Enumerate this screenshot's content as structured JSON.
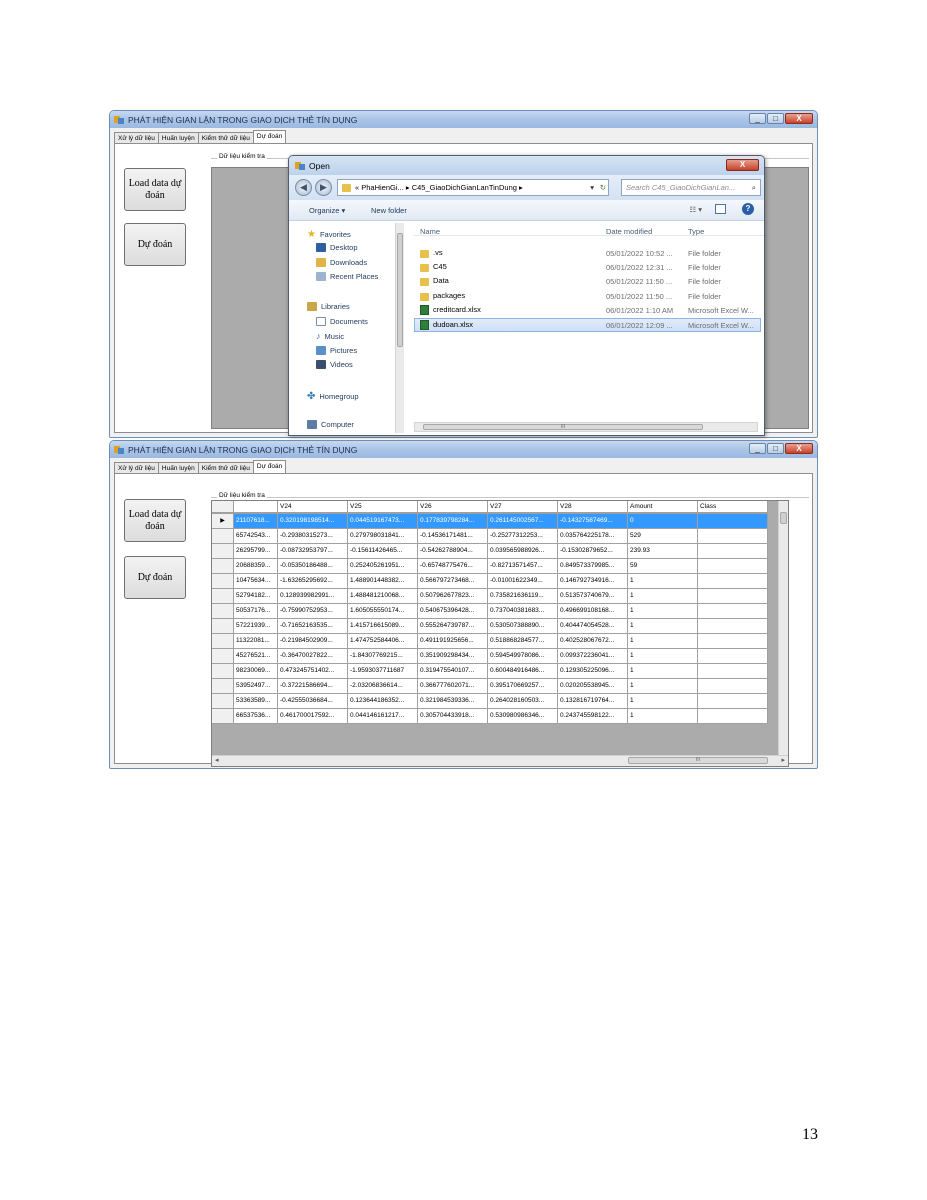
{
  "window": {
    "title": "PHÁT HIỆN GIAN LẬN TRONG GIAO DỊCH THẺ TÍN DỤNG",
    "min": "_",
    "max": "□",
    "close": "X"
  },
  "tabs": [
    "Xử lý dữ liệu",
    "Huấn luyện",
    "Kiểm thử dữ liệu",
    "Dự đoán"
  ],
  "buttons": {
    "load_data": "Load data dự đoán",
    "predict": "Dự đoán"
  },
  "groupbox_label": "Dữ liệu kiểm tra",
  "dialog": {
    "title": "Open",
    "path": "« PhaHienGi... ▸ C45_GiaoDichGianLanTinDung ▸",
    "search_placeholder": "Search C45_GiaoDichGianLan...",
    "organize": "Organize ▾",
    "new_folder": "New folder",
    "nav": {
      "favorites": "Favorites",
      "desktop": "Desktop",
      "downloads": "Downloads",
      "recent_places": "Recent Places",
      "libraries": "Libraries",
      "documents": "Documents",
      "music": "Music",
      "pictures": "Pictures",
      "videos": "Videos",
      "homegroup": "Homegroup",
      "computer": "Computer"
    },
    "columns": {
      "name": "Name",
      "date_modified": "Date modified",
      "type": "Type"
    },
    "files": [
      {
        "name": ".vs",
        "date": "05/01/2022 10:52 ...",
        "type": "File folder",
        "kind": "folder"
      },
      {
        "name": "C45",
        "date": "06/01/2022 12:31 ...",
        "type": "File folder",
        "kind": "folder"
      },
      {
        "name": "Data",
        "date": "05/01/2022 11:50 ...",
        "type": "File folder",
        "kind": "folder"
      },
      {
        "name": "packages",
        "date": "05/01/2022 11:50 ...",
        "type": "File folder",
        "kind": "folder"
      },
      {
        "name": "creditcard.xlsx",
        "date": "06/01/2022 1:10 AM",
        "type": "Microsoft Excel W...",
        "kind": "xlsx"
      },
      {
        "name": "dudoan.xlsx",
        "date": "06/01/2022 12:09 ...",
        "type": "Microsoft Excel W...",
        "kind": "xlsx"
      }
    ]
  },
  "grid": {
    "columns": [
      "",
      "V24",
      "V25",
      "V26",
      "V27",
      "V28",
      "Amount",
      "Class"
    ],
    "rows": [
      [
        "21107618...",
        "0.320198198514...",
        "0.044519167473...",
        "0.177839798284...",
        "0.261145002567...",
        "-0.14327587469...",
        "0",
        ""
      ],
      [
        "65742543...",
        "-0.29380315273...",
        "0.279798031841...",
        "-0.14536171481...",
        "-0.25277312253...",
        "0.035764225178...",
        "529",
        ""
      ],
      [
        "26295799...",
        "-0.08732953797...",
        "-0.15611426465...",
        "-0.54262788904...",
        "0.039565988926...",
        "-0.15302879652...",
        "239.93",
        ""
      ],
      [
        "20688359...",
        "-0.05350186488...",
        "0.252405261951...",
        "-0.65748775476...",
        "-0.82713571457...",
        "0.849573379985...",
        "59",
        ""
      ],
      [
        "10475634...",
        "-1.63265295692...",
        "1.488901448382...",
        "0.566797273468...",
        "-0.01001622349...",
        "0.146792734916...",
        "1",
        ""
      ],
      [
        "52794182...",
        "0.128939982991...",
        "1.488481210068...",
        "0.507962677823...",
        "0.735821636119...",
        "0.513573740679...",
        "1",
        ""
      ],
      [
        "50537176...",
        "-0.75990752953...",
        "1.605055550174...",
        "0.540675396428...",
        "0.737040381683...",
        "0.496699108168...",
        "1",
        ""
      ],
      [
        "57221939...",
        "-0.71652163535...",
        "1.415716615089...",
        "0.555264739787...",
        "0.530507388890...",
        "0.404474054528...",
        "1",
        ""
      ],
      [
        "11322081...",
        "-0.21984502909...",
        "1.474752584406...",
        "0.491191925656...",
        "0.518868284577...",
        "0.402528067672...",
        "1",
        ""
      ],
      [
        "45276521...",
        "-0.36470027822...",
        "-1.84307769215...",
        "0.351909298434...",
        "0.594549978086...",
        "0.099372236041...",
        "1",
        ""
      ],
      [
        "98230069...",
        "0.473245751402...",
        "-1.9593037711687",
        "0.319475540107...",
        "0.600484916486...",
        "0.129305225096...",
        "1",
        ""
      ],
      [
        "53952497...",
        "-0.37221586694...",
        "-2.03206836614...",
        "0.366777602071...",
        "0.395170669257...",
        "0.020205538945...",
        "1",
        ""
      ],
      [
        "53363589...",
        "-0.42555036684...",
        "0.123644186352...",
        "0.321984539336...",
        "0.264028160503...",
        "0.132816719764...",
        "1",
        ""
      ],
      [
        "66537536...",
        "0.461700017592...",
        "0.044146161217...",
        "0.305704433918...",
        "0.530980986346...",
        "0.243745598122...",
        "1",
        ""
      ]
    ],
    "scroll_marker": "III"
  },
  "page_number": "13"
}
